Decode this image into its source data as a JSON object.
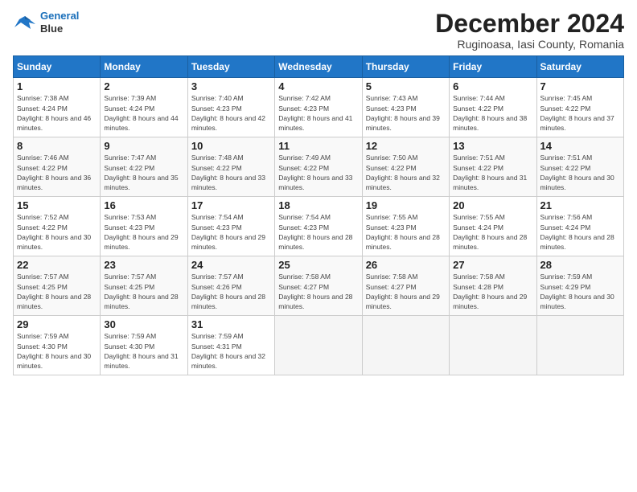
{
  "header": {
    "logo_line1": "General",
    "logo_line2": "Blue",
    "title": "December 2024",
    "subtitle": "Ruginoasa, Iasi County, Romania"
  },
  "days_of_week": [
    "Sunday",
    "Monday",
    "Tuesday",
    "Wednesday",
    "Thursday",
    "Friday",
    "Saturday"
  ],
  "weeks": [
    [
      {
        "day": 1,
        "sunrise": "7:38 AM",
        "sunset": "4:24 PM",
        "daylight": "8 hours and 46 minutes."
      },
      {
        "day": 2,
        "sunrise": "7:39 AM",
        "sunset": "4:24 PM",
        "daylight": "8 hours and 44 minutes."
      },
      {
        "day": 3,
        "sunrise": "7:40 AM",
        "sunset": "4:23 PM",
        "daylight": "8 hours and 42 minutes."
      },
      {
        "day": 4,
        "sunrise": "7:42 AM",
        "sunset": "4:23 PM",
        "daylight": "8 hours and 41 minutes."
      },
      {
        "day": 5,
        "sunrise": "7:43 AM",
        "sunset": "4:23 PM",
        "daylight": "8 hours and 39 minutes."
      },
      {
        "day": 6,
        "sunrise": "7:44 AM",
        "sunset": "4:22 PM",
        "daylight": "8 hours and 38 minutes."
      },
      {
        "day": 7,
        "sunrise": "7:45 AM",
        "sunset": "4:22 PM",
        "daylight": "8 hours and 37 minutes."
      }
    ],
    [
      {
        "day": 8,
        "sunrise": "7:46 AM",
        "sunset": "4:22 PM",
        "daylight": "8 hours and 36 minutes."
      },
      {
        "day": 9,
        "sunrise": "7:47 AM",
        "sunset": "4:22 PM",
        "daylight": "8 hours and 35 minutes."
      },
      {
        "day": 10,
        "sunrise": "7:48 AM",
        "sunset": "4:22 PM",
        "daylight": "8 hours and 33 minutes."
      },
      {
        "day": 11,
        "sunrise": "7:49 AM",
        "sunset": "4:22 PM",
        "daylight": "8 hours and 33 minutes."
      },
      {
        "day": 12,
        "sunrise": "7:50 AM",
        "sunset": "4:22 PM",
        "daylight": "8 hours and 32 minutes."
      },
      {
        "day": 13,
        "sunrise": "7:51 AM",
        "sunset": "4:22 PM",
        "daylight": "8 hours and 31 minutes."
      },
      {
        "day": 14,
        "sunrise": "7:51 AM",
        "sunset": "4:22 PM",
        "daylight": "8 hours and 30 minutes."
      }
    ],
    [
      {
        "day": 15,
        "sunrise": "7:52 AM",
        "sunset": "4:22 PM",
        "daylight": "8 hours and 30 minutes."
      },
      {
        "day": 16,
        "sunrise": "7:53 AM",
        "sunset": "4:23 PM",
        "daylight": "8 hours and 29 minutes."
      },
      {
        "day": 17,
        "sunrise": "7:54 AM",
        "sunset": "4:23 PM",
        "daylight": "8 hours and 29 minutes."
      },
      {
        "day": 18,
        "sunrise": "7:54 AM",
        "sunset": "4:23 PM",
        "daylight": "8 hours and 28 minutes."
      },
      {
        "day": 19,
        "sunrise": "7:55 AM",
        "sunset": "4:23 PM",
        "daylight": "8 hours and 28 minutes."
      },
      {
        "day": 20,
        "sunrise": "7:55 AM",
        "sunset": "4:24 PM",
        "daylight": "8 hours and 28 minutes."
      },
      {
        "day": 21,
        "sunrise": "7:56 AM",
        "sunset": "4:24 PM",
        "daylight": "8 hours and 28 minutes."
      }
    ],
    [
      {
        "day": 22,
        "sunrise": "7:57 AM",
        "sunset": "4:25 PM",
        "daylight": "8 hours and 28 minutes."
      },
      {
        "day": 23,
        "sunrise": "7:57 AM",
        "sunset": "4:25 PM",
        "daylight": "8 hours and 28 minutes."
      },
      {
        "day": 24,
        "sunrise": "7:57 AM",
        "sunset": "4:26 PM",
        "daylight": "8 hours and 28 minutes."
      },
      {
        "day": 25,
        "sunrise": "7:58 AM",
        "sunset": "4:27 PM",
        "daylight": "8 hours and 28 minutes."
      },
      {
        "day": 26,
        "sunrise": "7:58 AM",
        "sunset": "4:27 PM",
        "daylight": "8 hours and 29 minutes."
      },
      {
        "day": 27,
        "sunrise": "7:58 AM",
        "sunset": "4:28 PM",
        "daylight": "8 hours and 29 minutes."
      },
      {
        "day": 28,
        "sunrise": "7:59 AM",
        "sunset": "4:29 PM",
        "daylight": "8 hours and 30 minutes."
      }
    ],
    [
      {
        "day": 29,
        "sunrise": "7:59 AM",
        "sunset": "4:30 PM",
        "daylight": "8 hours and 30 minutes."
      },
      {
        "day": 30,
        "sunrise": "7:59 AM",
        "sunset": "4:30 PM",
        "daylight": "8 hours and 31 minutes."
      },
      {
        "day": 31,
        "sunrise": "7:59 AM",
        "sunset": "4:31 PM",
        "daylight": "8 hours and 32 minutes."
      },
      null,
      null,
      null,
      null
    ]
  ],
  "labels": {
    "sunrise": "Sunrise:",
    "sunset": "Sunset:",
    "daylight": "Daylight:"
  }
}
